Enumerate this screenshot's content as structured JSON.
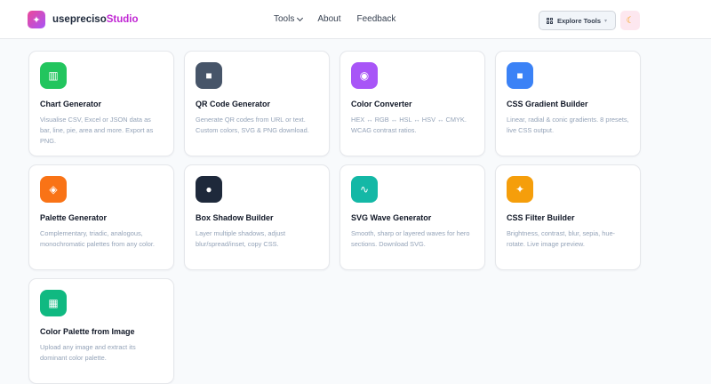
{
  "brand": {
    "name": "useprecisoStudio",
    "part1": "usepreciso",
    "part2": "Studio"
  },
  "nav": {
    "tools": "Tools",
    "about": "About",
    "feedback": "Feedback"
  },
  "explore_label": "Explore Tools",
  "cards": [
    {
      "title": "Chart Generator",
      "desc": "Visualise CSV, Excel or JSON data as bar, line, pie, area and more. Export as PNG.",
      "icon": "chart-icon",
      "color": "#22c55e"
    },
    {
      "title": "QR Code Generator",
      "desc": "Generate QR codes from URL or text. Custom colors, SVG & PNG download.",
      "icon": "qr-icon",
      "color": "#475569"
    },
    {
      "title": "Color Converter",
      "desc": "HEX ↔ RGB ↔ HSL ↔ HSV ↔ CMYK. WCAG contrast ratios.",
      "icon": "palette-icon",
      "color": "#a855f7"
    },
    {
      "title": "CSS Gradient Builder",
      "desc": "Linear, radial & conic gradients. 8 presets, live CSS output.",
      "icon": "square-icon",
      "color": "#3b82f6"
    },
    {
      "title": "Palette Generator",
      "desc": "Complementary, triadic, analogous, monochromatic palettes from any color.",
      "icon": "swatch-icon",
      "color": "#f97316"
    },
    {
      "title": "Box Shadow Builder",
      "desc": "Layer multiple shadows, adjust blur/spread/inset, copy CSS.",
      "icon": "orb-icon",
      "color": "#1e293b"
    },
    {
      "title": "SVG Wave Generator",
      "desc": "Smooth, sharp or layered waves for hero sections. Download SVG.",
      "icon": "wave-icon",
      "color": "#14b8a6"
    },
    {
      "title": "CSS Filter Builder",
      "desc": "Brightness, contrast, blur, sepia, hue-rotate. Live image preview.",
      "icon": "sparkle-icon",
      "color": "#f59e0b"
    },
    {
      "title": "Color Palette from Image",
      "desc": "Upload any image and extract its dominant color palette.",
      "icon": "image-icon",
      "color": "#10b981"
    }
  ]
}
